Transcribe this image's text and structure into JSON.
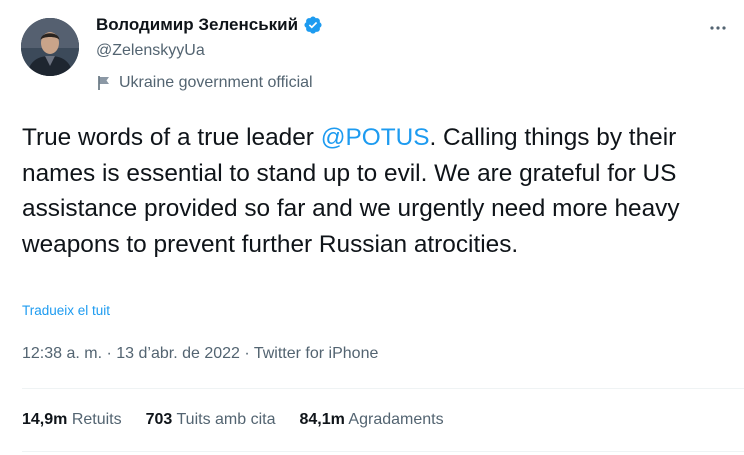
{
  "author": {
    "display_name": "Володимир Зеленський",
    "handle": "@ZelenskyyUa",
    "label": "Ukraine government official"
  },
  "tweet": {
    "text_before": "True words of a true leader ",
    "mention": "@POTUS",
    "text_after": ". Calling things by their names is essential to stand up to evil. We are grateful for US assistance provided so far and we urgently need more heavy weapons to prevent further Russian atrocities.",
    "translate_link": "Tradueix el tuit",
    "meta": "12:38 a. m. · 13 d’abr. de 2022 · Twitter for iPhone"
  },
  "stats": {
    "retweets_count": "14,9m",
    "retweets_label": "Retuits",
    "quotes_count": "703",
    "quotes_label": "Tuits amb cita",
    "likes_count": "84,1m",
    "likes_label": "Agradaments"
  },
  "icons": {
    "verified": "verified-badge-icon",
    "flag": "flag-icon",
    "more": "more-dots-icon"
  },
  "colors": {
    "accent": "#1d9bf0",
    "text": "#0f1419",
    "secondary": "#536471"
  }
}
